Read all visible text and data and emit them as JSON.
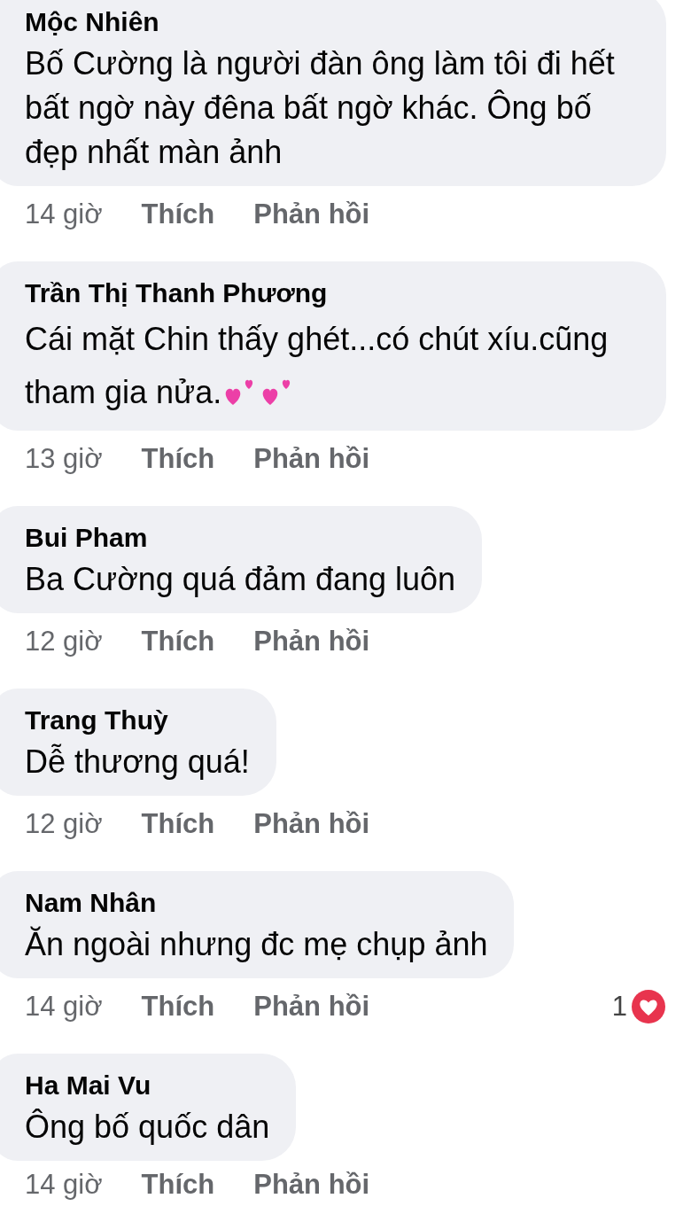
{
  "comments": [
    {
      "author": "Mộc Nhiên",
      "body": "Bố Cường là người đàn ông làm tôi đi hết bất ngờ này đêna bất ngờ khác. Ông bố đẹp nhất màn ảnh",
      "hearts_emoji": false,
      "time": "14 giờ",
      "like": "Thích",
      "reply": "Phản hồi"
    },
    {
      "author": "Trần Thị Thanh Phương",
      "body": "Cái mặt Chin thấy ghét...có chút xíu.cũng tham gia nửa.",
      "hearts_emoji": true,
      "time": "13 giờ",
      "like": "Thích",
      "reply": "Phản hồi"
    },
    {
      "author": "Bui Pham",
      "body": "Ba Cường quá đảm đang luôn",
      "hearts_emoji": false,
      "time": "12 giờ",
      "like": "Thích",
      "reply": "Phản hồi"
    },
    {
      "author": "Trang Thuỳ",
      "body": "Dễ thương quá!",
      "hearts_emoji": false,
      "time": "12 giờ",
      "like": "Thích",
      "reply": "Phản hồi"
    },
    {
      "author": "Nam Nhân",
      "body": "Ăn ngoài nhưng đc mẹ chụp ảnh",
      "hearts_emoji": false,
      "time": "14 giờ",
      "like": "Thích",
      "reply": "Phản hồi",
      "reactions": {
        "count": "1"
      }
    },
    {
      "author": "Ha Mai Vu",
      "body": "Ông bố quốc dân",
      "hearts_emoji": false,
      "time": "14 giờ",
      "like": "Thích",
      "reply": "Phản hồi"
    }
  ]
}
